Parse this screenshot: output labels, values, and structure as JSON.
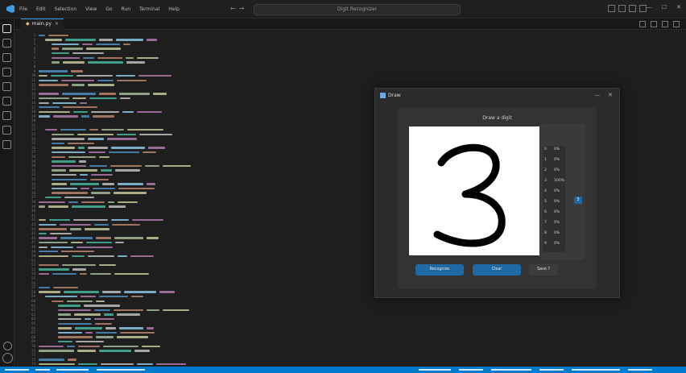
{
  "titlebar": {
    "menu": [
      "File",
      "Edit",
      "Selection",
      "View",
      "Go",
      "Run",
      "Terminal",
      "Help"
    ],
    "search_placeholder": "Digit Recognizer",
    "window_controls": [
      "—",
      "☐",
      "✕"
    ]
  },
  "tab": {
    "filename": "main.py",
    "close": "×"
  },
  "code_line_numbers": [
    "1",
    "2",
    "3",
    "4",
    "5",
    "6",
    "7",
    "8",
    "9",
    "10",
    "11",
    "12",
    "13",
    "14",
    "15",
    "16",
    "17",
    "18",
    "19",
    "20",
    "21",
    "22",
    "23",
    "24",
    "25",
    "26",
    "27",
    "28",
    "29",
    "30",
    "31",
    "32",
    "33",
    "34",
    "35",
    "36",
    "37",
    "38",
    "39",
    "40",
    "41",
    "42",
    "43",
    "44",
    "45",
    "46",
    "47",
    "48",
    "49",
    "50",
    "51",
    "52",
    "53",
    "54",
    "55",
    "56",
    "57",
    "58",
    "59",
    "60",
    "61",
    "62",
    "63",
    "64",
    "65",
    "66",
    "67",
    "68",
    "69",
    "70",
    "71",
    "72",
    "73",
    "74"
  ],
  "app": {
    "title": "Draw",
    "header": "Draw a digit",
    "drawn_digit": "3",
    "probabilities": [
      {
        "digit": "0",
        "prob": "0%"
      },
      {
        "digit": "1",
        "prob": "0%"
      },
      {
        "digit": "2",
        "prob": "0%"
      },
      {
        "digit": "3",
        "prob": "100%"
      },
      {
        "digit": "4",
        "prob": "0%"
      },
      {
        "digit": "5",
        "prob": "0%"
      },
      {
        "digit": "6",
        "prob": "0%"
      },
      {
        "digit": "7",
        "prob": "0%"
      },
      {
        "digit": "8",
        "prob": "0%"
      },
      {
        "digit": "9",
        "prob": "0%"
      }
    ],
    "prediction": "3",
    "buttons": [
      "Recognize",
      "Clear",
      "Save ?"
    ],
    "controls": [
      "—",
      "✕"
    ]
  },
  "colors": {
    "accent": "#007acc",
    "button_blue": "#1f6aa5",
    "editor_bg": "#1e1e1e"
  }
}
